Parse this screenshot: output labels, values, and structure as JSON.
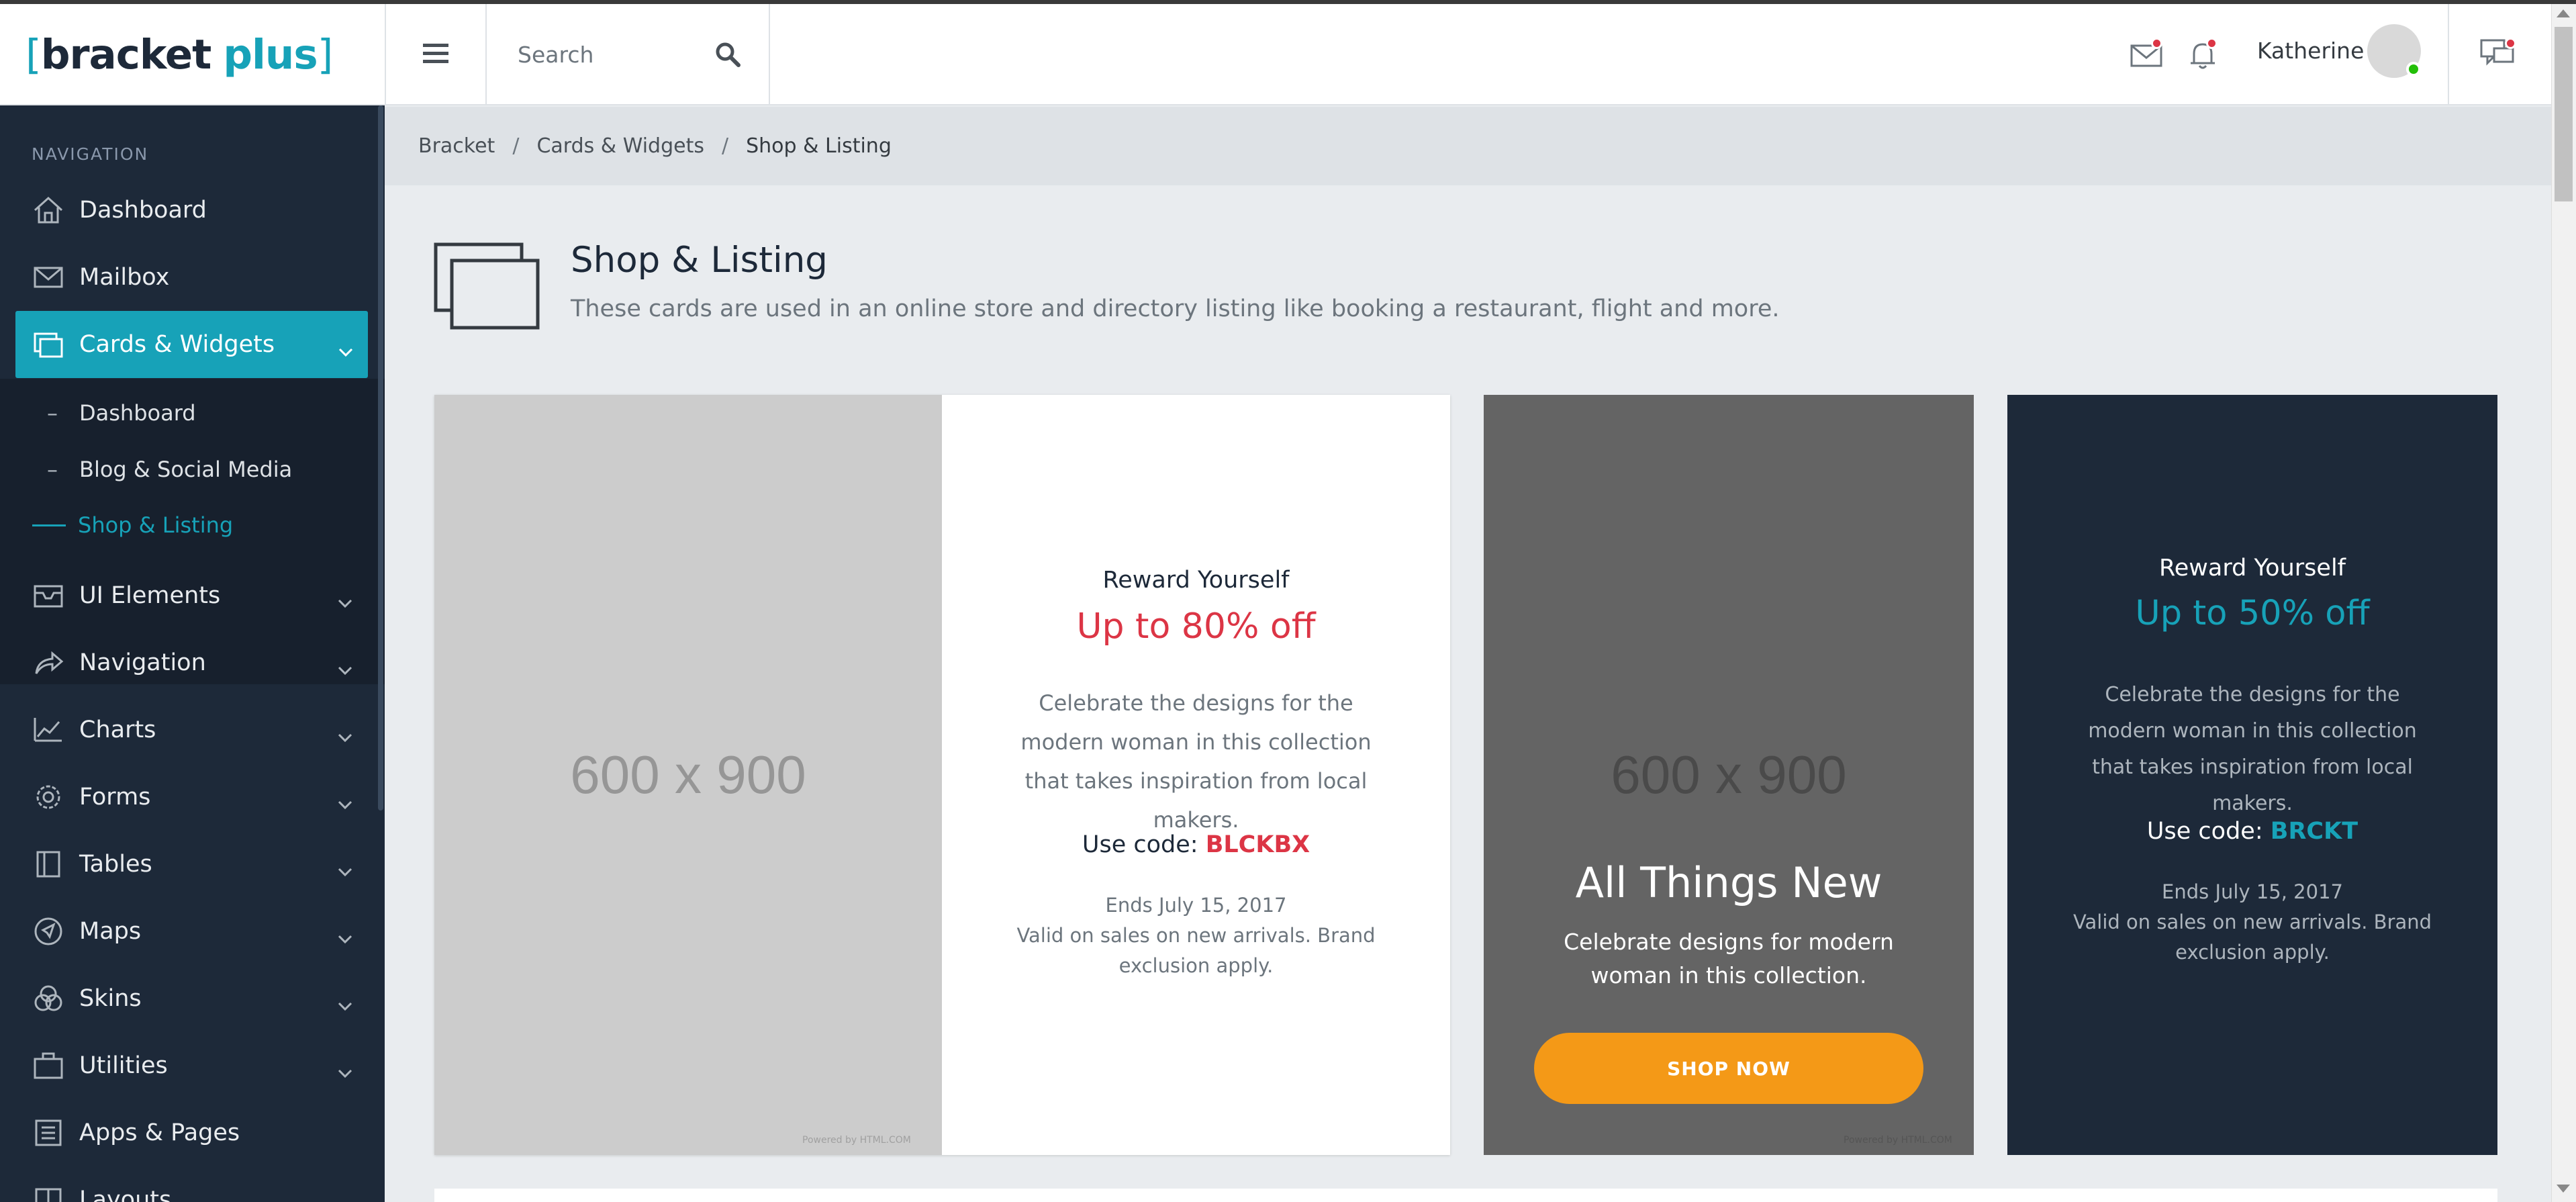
{
  "header": {
    "logo": {
      "bracket_open": "[",
      "word1": "bracket",
      "word2": "plus",
      "bracket_close": "]"
    },
    "search_placeholder": "Search",
    "username": "Katherine"
  },
  "sidebar": {
    "section_label": "NAVIGATION",
    "items": [
      {
        "label": "Dashboard",
        "icon": "home-icon"
      },
      {
        "label": "Mailbox",
        "icon": "envelope-icon"
      },
      {
        "label": "Cards & Widgets",
        "icon": "cards-icon",
        "active": true
      },
      {
        "label": "UI Elements",
        "icon": "ui-icon"
      },
      {
        "label": "Navigation",
        "icon": "share-icon"
      },
      {
        "label": "Charts",
        "icon": "chart-icon"
      },
      {
        "label": "Forms",
        "icon": "gear-icon"
      },
      {
        "label": "Tables",
        "icon": "table-icon"
      },
      {
        "label": "Maps",
        "icon": "navigate-icon"
      },
      {
        "label": "Skins",
        "icon": "skins-icon"
      },
      {
        "label": "Utilities",
        "icon": "briefcase-icon"
      },
      {
        "label": "Apps & Pages",
        "icon": "pages-icon"
      },
      {
        "label": "Layouts",
        "icon": "layout-icon"
      }
    ],
    "subitems": [
      {
        "label": "Dashboard",
        "prefix": "–"
      },
      {
        "label": "Blog & Social Media",
        "prefix": "–"
      },
      {
        "label": "Shop & Listing",
        "active": true
      }
    ]
  },
  "breadcrumb": [
    "Bracket",
    "Cards & Widgets",
    "Shop & Listing"
  ],
  "page": {
    "title": "Shop & Listing",
    "description": "These cards are used in an online store and directory listing like booking a restaurant, flight and more."
  },
  "card1": {
    "image_placeholder": "600 x 900",
    "powered": "Powered by HTML.COM",
    "kicker": "Reward Yourself",
    "offer": "Up to 80% off",
    "text": "Celebrate the designs for the modern woman in this collection that takes inspiration from local makers.",
    "code_label": "Use code:",
    "code": "BLCKBX",
    "ends": "Ends July 15, 2017",
    "terms": "Valid on sales on new arrivals. Brand exclusion apply."
  },
  "card2": {
    "image_placeholder": "600 x 900",
    "powered": "Powered by HTML.COM",
    "title": "All Things New",
    "text": "Celebrate designs for modern woman in this collection.",
    "button": "SHOP NOW"
  },
  "card3": {
    "kicker": "Reward Yourself",
    "offer": "Up to 50% off",
    "text": "Celebrate the designs for the modern woman in this collection that takes inspiration from local makers.",
    "code_label": "Use code:",
    "code": "BRCKT",
    "ends": "Ends July 15, 2017",
    "terms": "Valid on sales on new arrivals. Brand exclusion apply."
  },
  "colors": {
    "accent": "#17a2b8",
    "sidebar": "#1d2939",
    "danger": "#dc3545",
    "orange": "#f49917"
  }
}
